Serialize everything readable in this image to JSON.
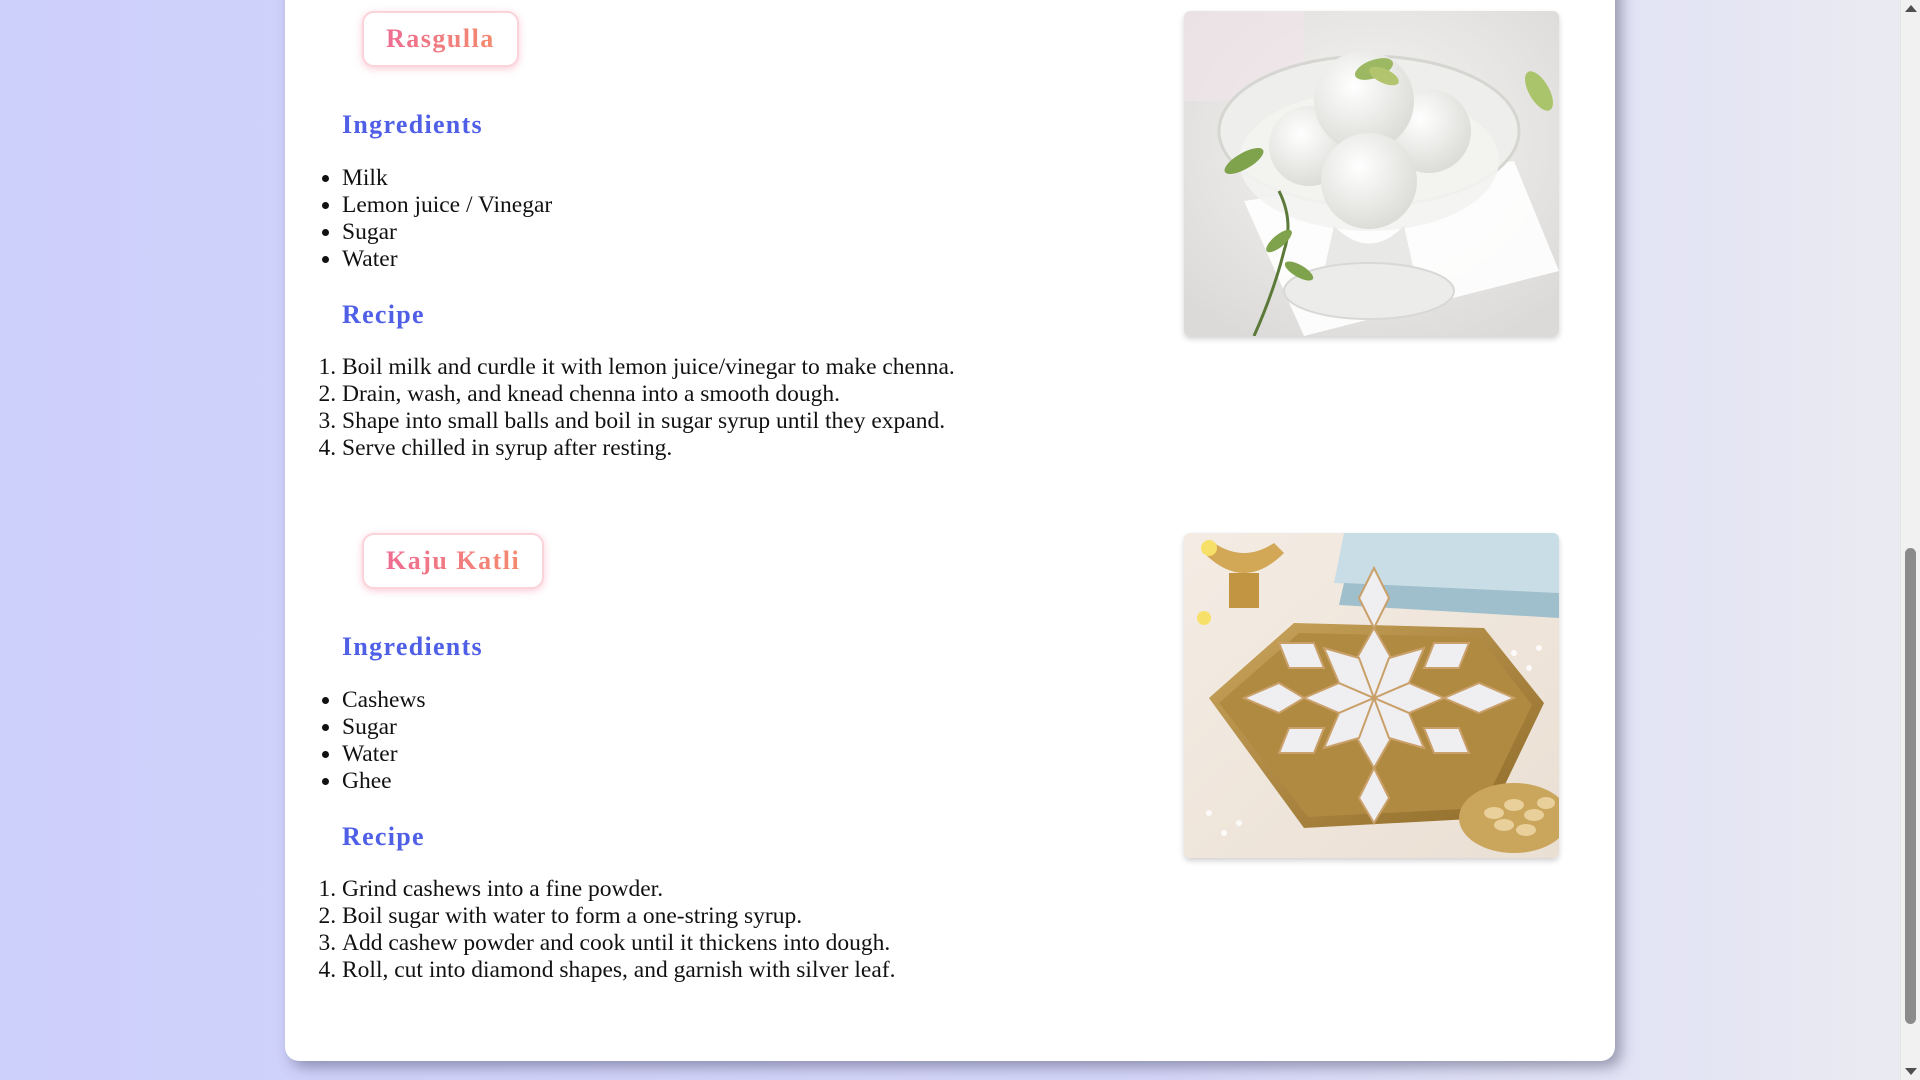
{
  "recipes": [
    {
      "name": "Rasgulla",
      "ingredients_title": "Ingredients",
      "ingredients": [
        "Milk",
        "Lemon juice / Vinegar",
        "Sugar",
        "Water"
      ],
      "recipe_title": "Recipe",
      "steps": [
        "Boil milk and curdle it with lemon juice/vinegar to make chenna.",
        "Drain, wash, and knead chenna into a smooth dough.",
        "Shape into small balls and boil in sugar syrup until they expand.",
        "Serve chilled in syrup after resting."
      ],
      "image_icon": "rasgulla-photo"
    },
    {
      "name": "Kaju Katli",
      "ingredients_title": "Ingredients",
      "ingredients": [
        "Cashews",
        "Sugar",
        "Water",
        "Ghee"
      ],
      "recipe_title": "Recipe",
      "steps": [
        "Grind cashews into a fine powder.",
        "Boil sugar with water to form a one-string syrup.",
        "Add cashew powder and cook until it thickens into dough.",
        "Roll, cut into diamond shapes, and garnish with silver leaf."
      ],
      "image_icon": "kaju-katli-photo"
    }
  ],
  "colors": {
    "page_background": "#cdd0fb",
    "card": "#ffffff",
    "heading_blue": "#4f5fe6",
    "badge_pink": "#ee6d93",
    "badge_orange": "#f48a6e"
  }
}
